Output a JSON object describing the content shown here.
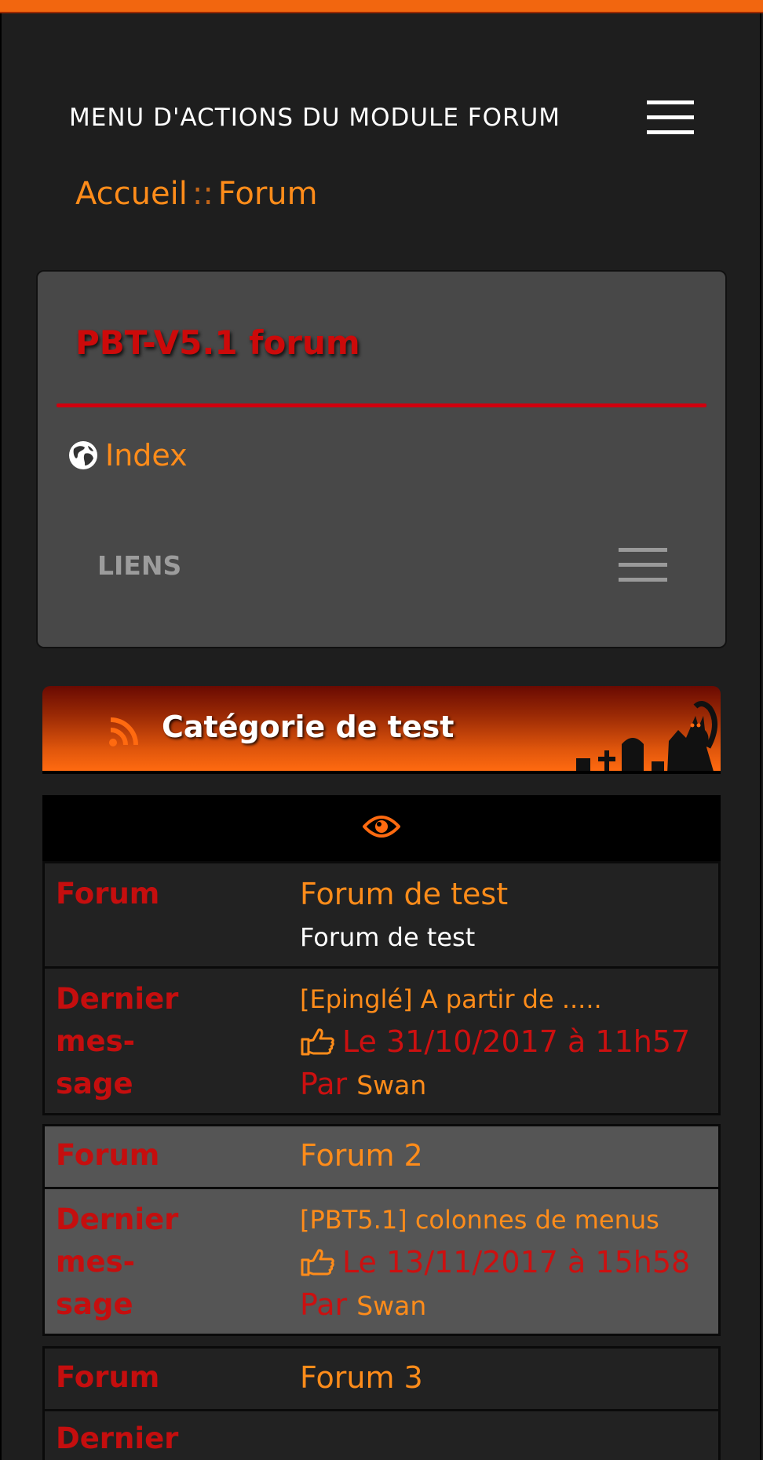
{
  "header": {
    "menu_title": "MENU D'ACTIONS DU MODULE FORUM",
    "menu_icon": "hamburger-icon",
    "accent_color": "#f2660f"
  },
  "breadcrumb": {
    "home": "Accueil",
    "separator": "::",
    "current": "Forum"
  },
  "block": {
    "title": "PBT-V5.1 forum",
    "index_label": "Index",
    "index_icon": "globe-icon",
    "links_label": "LIENS",
    "links_icon": "hamburger-icon"
  },
  "category": {
    "title": "Catégorie de test",
    "icon": "rss-icon",
    "view_icon": "eye-icon"
  },
  "forums": [
    {
      "forum_label": "Forum",
      "name": "Forum de test",
      "description": "Forum de test",
      "last_label": "Dernier mes-sage",
      "last_label_line1": "Dernier mes-",
      "last_label_line2": "sage",
      "last_title": "[Epinglé] A partir de .....",
      "last_date": "Le 31/10/2017 à 11h57",
      "by_label": "Par",
      "last_user": "Swan"
    },
    {
      "forum_label": "Forum",
      "name": "Forum 2",
      "last_label_line1": "Dernier mes-",
      "last_label_line2": "sage",
      "last_title": "[PBT5.1] colonnes de menus",
      "last_date": "Le 13/11/2017 à 15h58",
      "by_label": "Par",
      "last_user": "Swan"
    },
    {
      "forum_label": "Forum",
      "name": "Forum 3",
      "last_label_line1": "Dernier mes-"
    }
  ]
}
